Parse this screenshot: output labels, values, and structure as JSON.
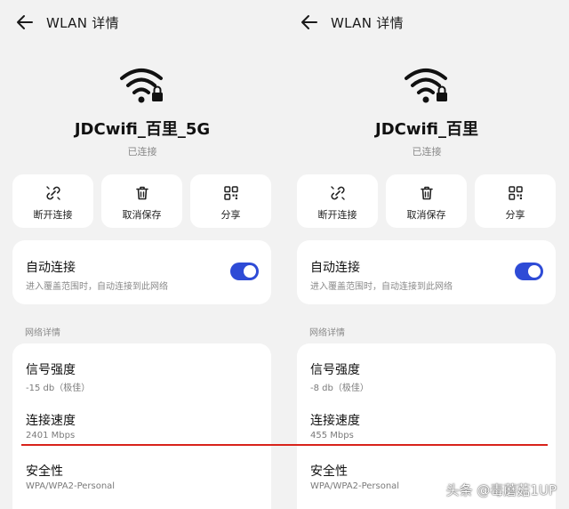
{
  "panels": [
    {
      "title": "WLAN 详情",
      "network_name": "JDCwifi_百里_5G",
      "status": "已连接",
      "actions": [
        "断开连接",
        "取消保存",
        "分享"
      ],
      "auto_connect": {
        "title": "自动连接",
        "subtitle": "进入覆盖范围时，自动连接到此网络",
        "enabled": true
      },
      "section_label": "网络详情",
      "details": [
        {
          "label": "信号强度",
          "value": "-15 db（极佳）"
        },
        {
          "label": "连接速度",
          "value": "2401 Mbps"
        },
        {
          "label": "安全性",
          "value": "WPA/WPA2-Personal"
        }
      ]
    },
    {
      "title": "WLAN 详情",
      "network_name": "JDCwifi_百里",
      "status": "已连接",
      "actions": [
        "断开连接",
        "取消保存",
        "分享"
      ],
      "auto_connect": {
        "title": "自动连接",
        "subtitle": "进入覆盖范围时，自动连接到此网络",
        "enabled": true
      },
      "section_label": "网络详情",
      "details": [
        {
          "label": "信号强度",
          "value": "-8 db（极佳）"
        },
        {
          "label": "连接速度",
          "value": "455 Mbps"
        },
        {
          "label": "安全性",
          "value": "WPA/WPA2-Personal"
        }
      ]
    }
  ],
  "watermark": "头条 @毒蘑菇1UP",
  "colors": {
    "accent": "#2e4bd6",
    "highlight_line": "#d8231b",
    "background": "#f2f2f2"
  },
  "icons": [
    "back-arrow-icon",
    "wifi-lock-icon",
    "unlink-icon",
    "trash-icon",
    "qr-code-icon"
  ]
}
